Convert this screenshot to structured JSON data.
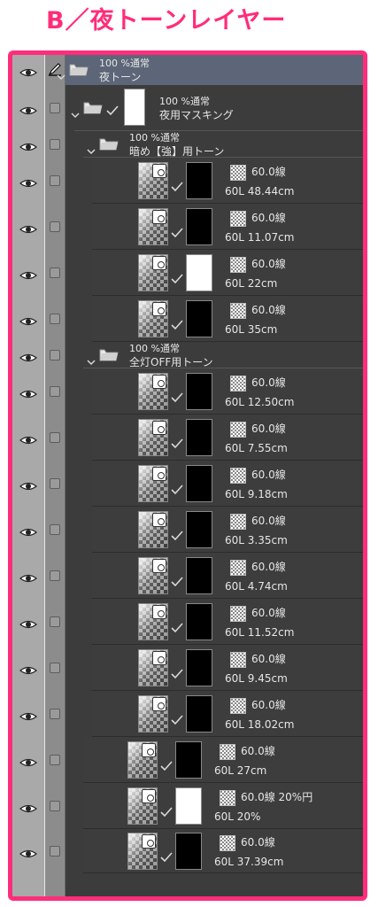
{
  "title": "B／夜トーンレイヤー",
  "colors": {
    "accent": "#ff2d7a",
    "panel_bg": "#3c3c3c",
    "selected_row": "#5c6678",
    "eye_column": "#a9a9a9",
    "lock_column": "#8c8c8c"
  },
  "icons": {
    "visibility": "eye-icon",
    "edit": "pencil-icon",
    "lock": "checkbox-icon",
    "folder": "folder-icon",
    "expand": "chevron-down-icon",
    "linked": "check-icon",
    "tone": "checker-tone-icon"
  },
  "layers": [
    {
      "kind": "folder",
      "top": "100 %通常",
      "bottom": "夜トーン",
      "selected": true
    },
    {
      "kind": "mask_folder",
      "top": "100 %通常",
      "bottom": "夜用マスキング"
    },
    {
      "kind": "folder",
      "top": "100 %通常",
      "bottom": "暗め【強】用トーン"
    },
    {
      "kind": "tone",
      "line": "60.0線",
      "sub": "60L 48.44cm"
    },
    {
      "kind": "tone",
      "line": "60.0線",
      "sub": "60L 11.07cm"
    },
    {
      "kind": "tone",
      "line": "60.0線",
      "sub": "60L 22cm"
    },
    {
      "kind": "tone",
      "line": "60.0線",
      "sub": "60L 35cm"
    },
    {
      "kind": "folder",
      "top": "100 %通常",
      "bottom": "全灯OFF用トーン"
    },
    {
      "kind": "tone",
      "line": "60.0線",
      "sub": "60L 12.50cm"
    },
    {
      "kind": "tone",
      "line": "60.0線",
      "sub": "60L 7.55cm"
    },
    {
      "kind": "tone",
      "line": "60.0線",
      "sub": "60L 9.18cm"
    },
    {
      "kind": "tone",
      "line": "60.0線",
      "sub": "60L 3.35cm"
    },
    {
      "kind": "tone",
      "line": "60.0線",
      "sub": "60L 4.74cm"
    },
    {
      "kind": "tone",
      "line": "60.0線",
      "sub": "60L 11.52cm"
    },
    {
      "kind": "tone",
      "line": "60.0線",
      "sub": "60L 9.45cm"
    },
    {
      "kind": "tone",
      "line": "60.0線",
      "sub": "60L 18.02cm"
    },
    {
      "kind": "tone",
      "line": "60.0線",
      "sub": "60L 27cm"
    },
    {
      "kind": "tone",
      "line": "60.0線 20%円",
      "sub": "60L 20%"
    },
    {
      "kind": "tone",
      "line": "60.0線",
      "sub": "60L 37.39cm"
    }
  ]
}
